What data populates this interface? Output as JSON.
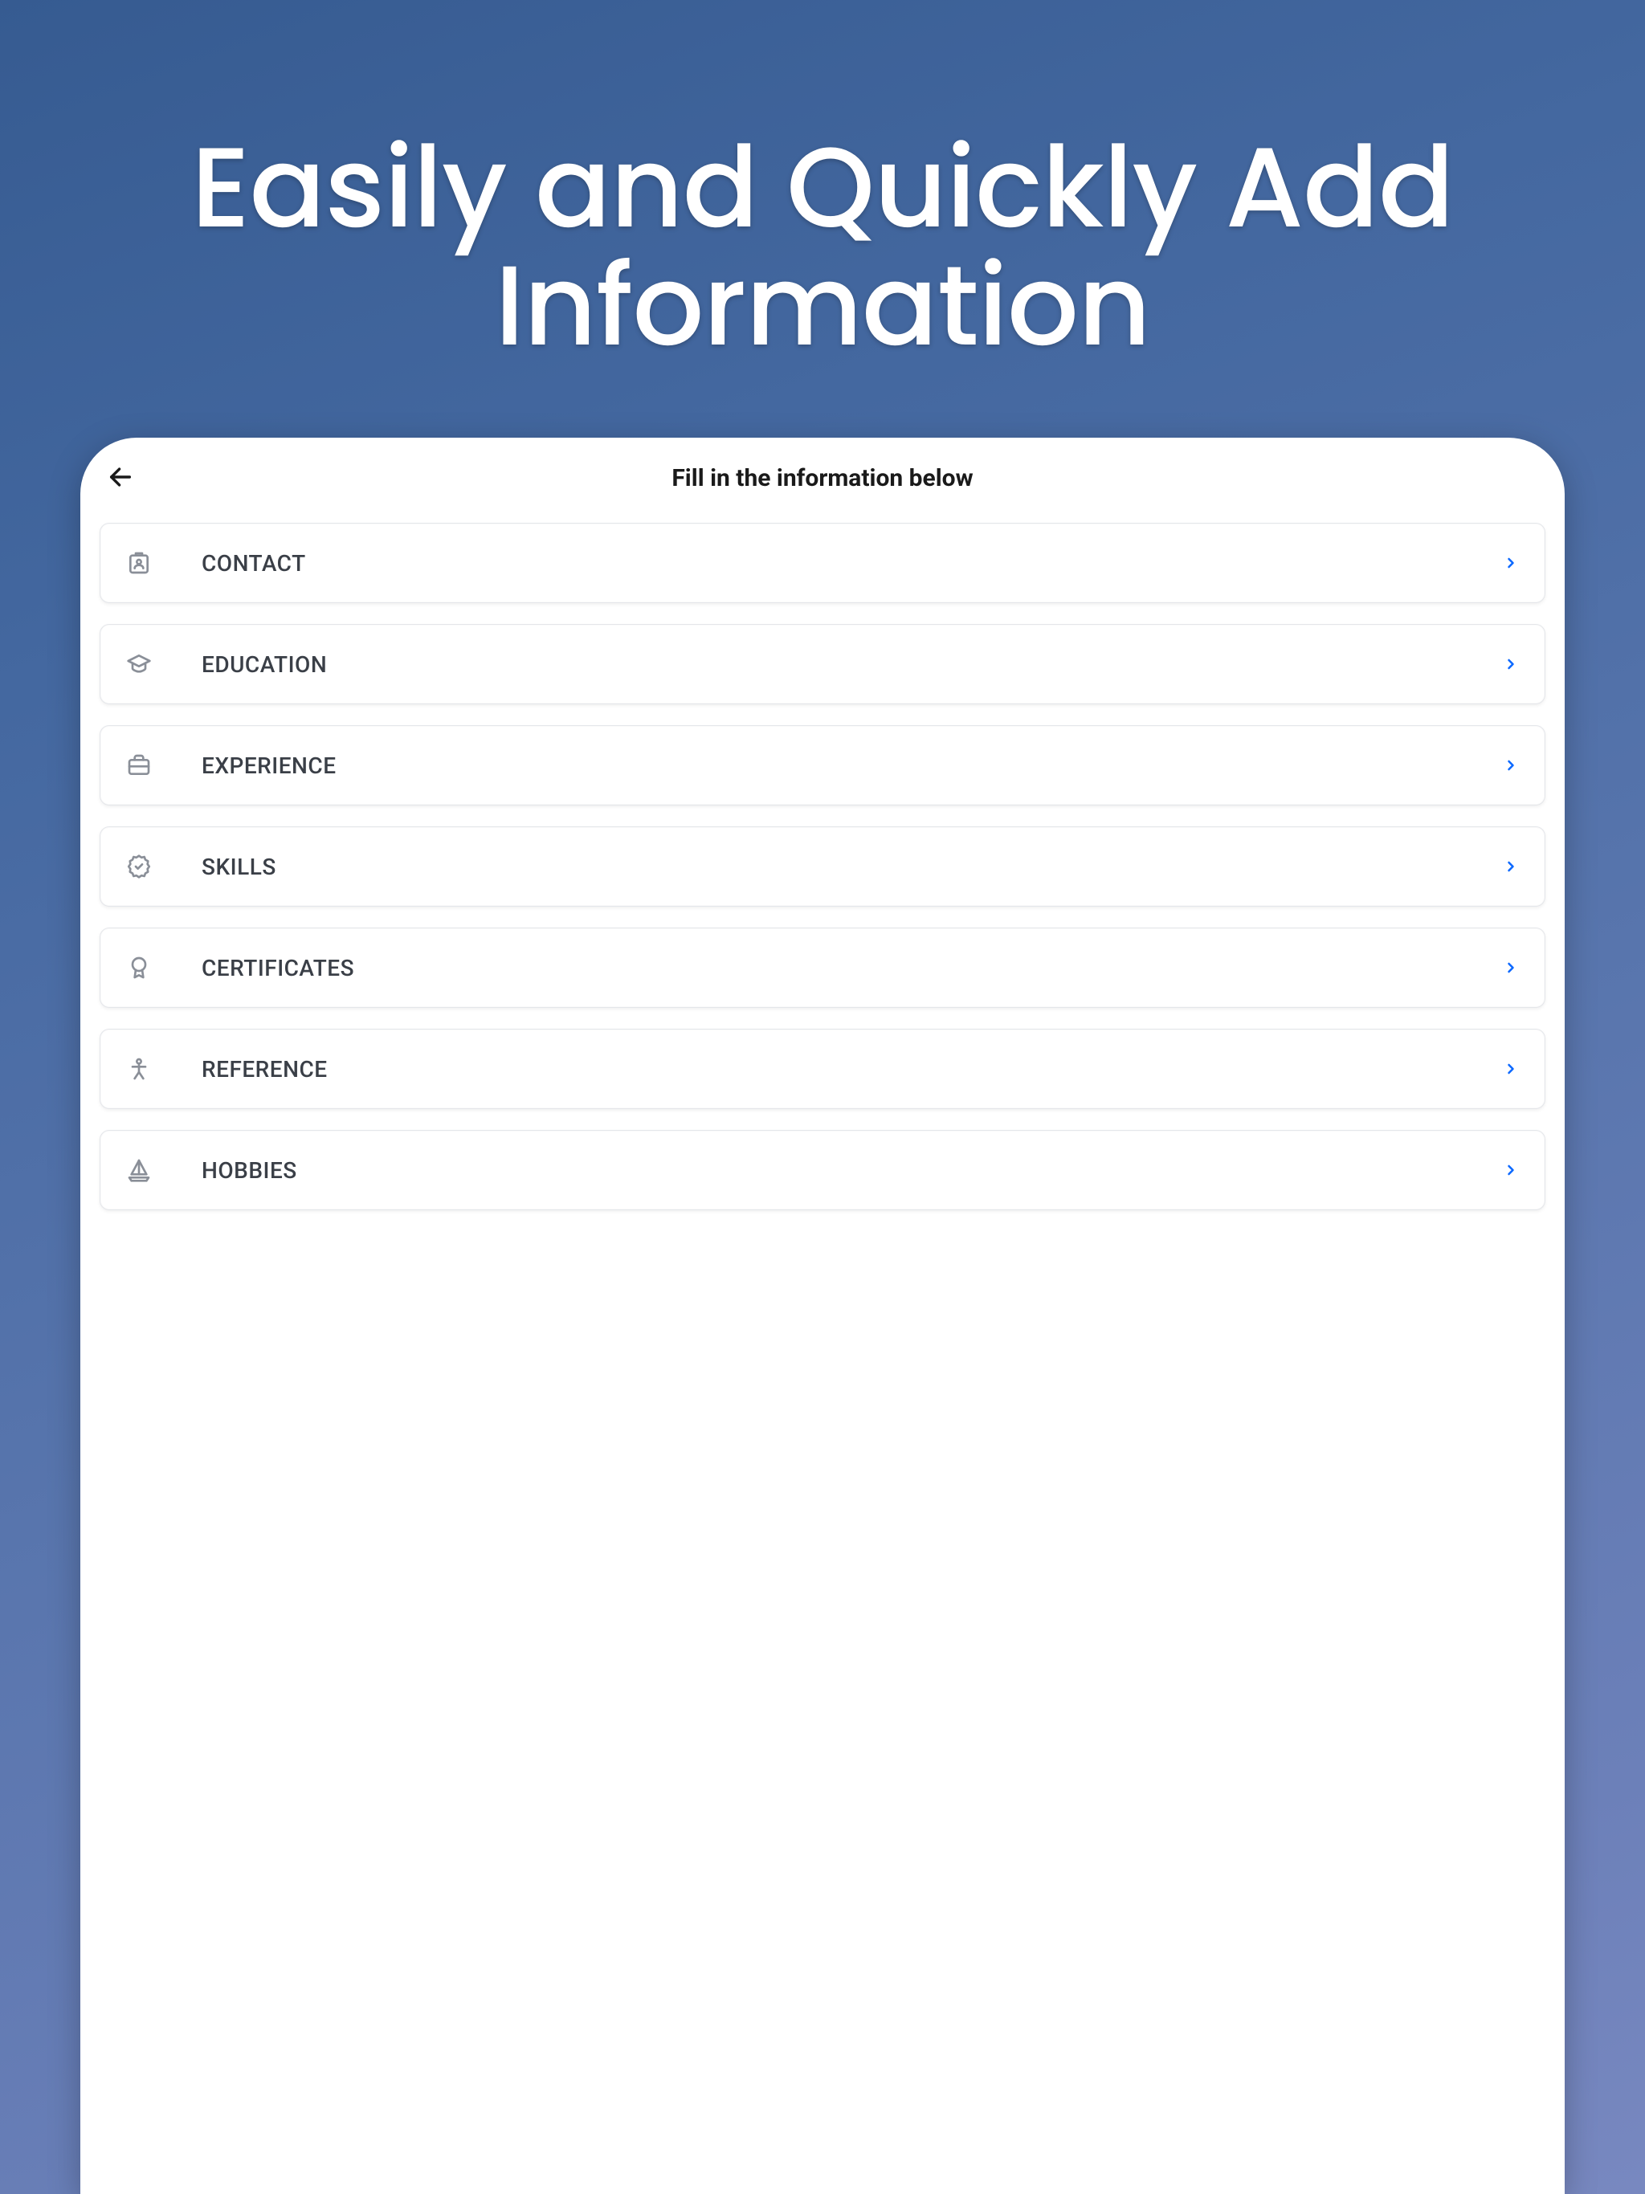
{
  "hero": {
    "title": "Easily and Quickly Add Information"
  },
  "app": {
    "header_title": "Fill in the information below",
    "sections": [
      {
        "label": "CONTACT"
      },
      {
        "label": "EDUCATION"
      },
      {
        "label": "EXPERIENCE"
      },
      {
        "label": "SKILLS"
      },
      {
        "label": "CERTIFICATES"
      },
      {
        "label": "REFERENCE"
      },
      {
        "label": "HOBBIES"
      }
    ]
  }
}
